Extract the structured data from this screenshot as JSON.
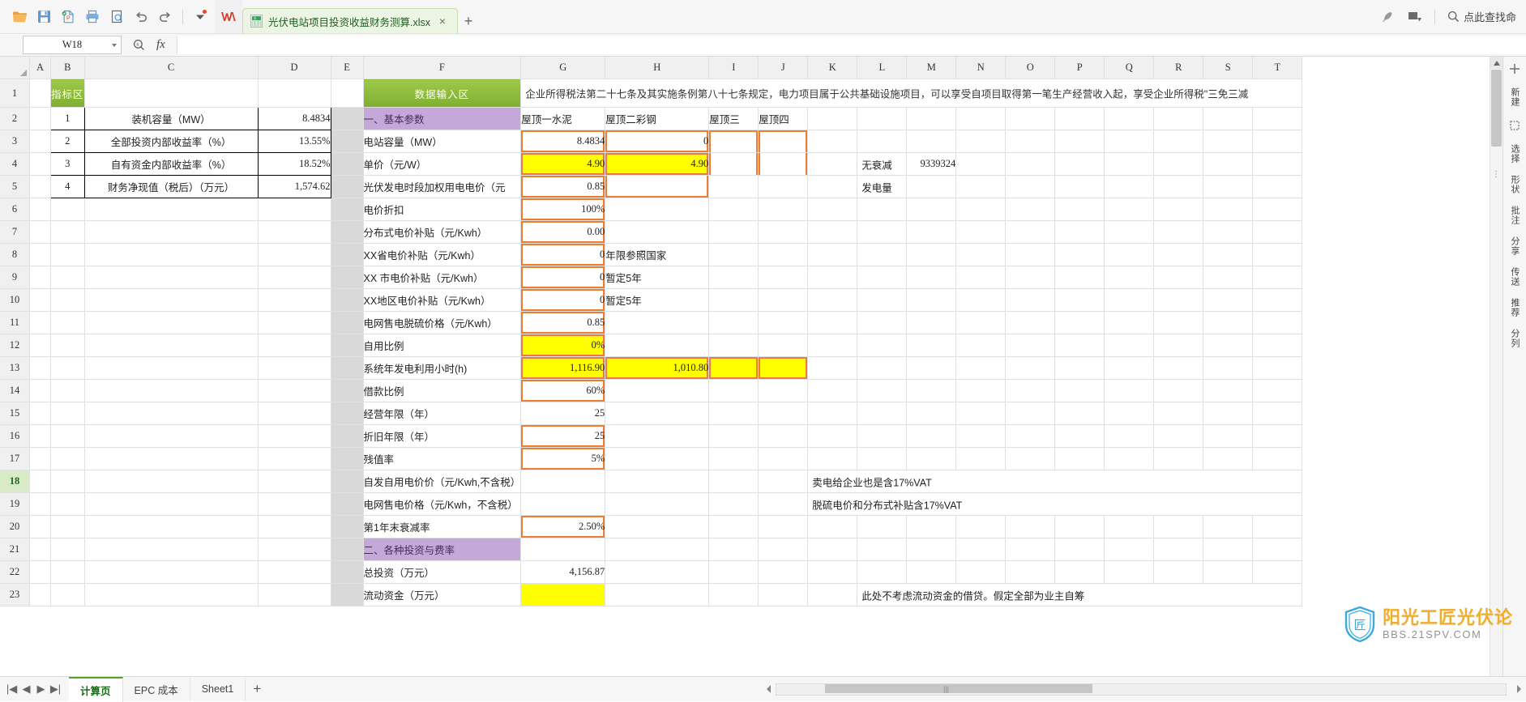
{
  "window": {
    "app_name": "WPS Spreadsheets",
    "document_tab": "光伏电站项目投资收益财务测算.xlsx",
    "new_tab_label": "+",
    "close_label": "×",
    "search_placeholder": "点此查找命"
  },
  "quick_access": [
    {
      "name": "open-icon",
      "tip": "打开"
    },
    {
      "name": "save-icon",
      "tip": "保存"
    },
    {
      "name": "export-pdf-icon",
      "tip": "输出为PDF"
    },
    {
      "name": "print-icon",
      "tip": "打印"
    },
    {
      "name": "print-preview-icon",
      "tip": "打印预览"
    },
    {
      "name": "undo-icon",
      "tip": "撤消"
    },
    {
      "name": "redo-icon",
      "tip": "恢复"
    },
    {
      "name": "customize-dropdown-icon",
      "tip": "自定义快速访问工具栏"
    }
  ],
  "formula_bar": {
    "name_box": "W18",
    "zoom_icon": "search-icon",
    "fx_label": "fx",
    "formula_value": ""
  },
  "grid": {
    "columns": [
      "A",
      "B",
      "C",
      "D",
      "E",
      "F",
      "G",
      "H",
      "I",
      "J",
      "K",
      "L",
      "M",
      "N",
      "O",
      "P",
      "Q",
      "R",
      "S",
      "T"
    ],
    "rows": [
      "1",
      "2",
      "3",
      "4",
      "5",
      "6",
      "7",
      "8",
      "9",
      "10",
      "11",
      "12",
      "13",
      "14",
      "15",
      "16",
      "17",
      "18",
      "19",
      "20",
      "21",
      "22",
      "23"
    ],
    "selected_row": "18",
    "selected_cell": "W18"
  },
  "section_headers": {
    "indicator": "指标区",
    "data_input": "数据输入区",
    "basic_params": "一、基本参数",
    "investment_rates": "二、各种投资与费率"
  },
  "indicator_table": [
    {
      "no": "1",
      "label": "装机容量（MW）",
      "value": "8.4834"
    },
    {
      "no": "2",
      "label": "全部投资内部收益率（%）",
      "value": "13.55%"
    },
    {
      "no": "3",
      "label": "自有资金内部收益率（%）",
      "value": "18.52%"
    },
    {
      "no": "4",
      "label": "财务净现值（税后）（万元）",
      "value": "1,574.62"
    }
  ],
  "tax_note": "企业所得税法第二十七条及其实施条例第八十七条规定，电力项目属于公共基础设施项目，可以享受自项目取得第一笔生产经营收入起，享受企业所得税\"三免三减",
  "scenario_headers": [
    "屋顶一水泥",
    "屋顶二彩钢",
    "屋顶三",
    "屋顶四"
  ],
  "no_degradation": {
    "label_line1": "无衰减",
    "label_line2": "发电量",
    "value": "9339324"
  },
  "param_rows": [
    {
      "row": "3",
      "label": "电站容量（MW）",
      "g": "8.4834",
      "h": "0",
      "i": "",
      "j": "",
      "note": "",
      "g_style": "orange",
      "h_style": "orange"
    },
    {
      "row": "4",
      "label": "单价（元/W）",
      "g": "4.90",
      "h": "4.90",
      "i": "",
      "j": "",
      "note": "",
      "g_style": "yellow-orange",
      "h_style": "yellow-orange"
    },
    {
      "row": "5",
      "label": "光伏发电时段加权用电电价（元",
      "g": "0.85",
      "h": "",
      "i": "",
      "j": "",
      "note": "",
      "g_style": "orange",
      "h_style": "orange"
    },
    {
      "row": "6",
      "label": "电价折扣",
      "g": "100%",
      "h": "",
      "i": "",
      "j": "",
      "note": "",
      "g_style": "orange",
      "h_style": ""
    },
    {
      "row": "7",
      "label": "分布式电价补贴（元/Kwh）",
      "g": "0.00",
      "h": "",
      "i": "",
      "j": "",
      "note": "",
      "g_style": "orange",
      "h_style": ""
    },
    {
      "row": "8",
      "label": "XX省电价补贴（元/Kwh）",
      "g": "0",
      "h": "年限参照国家",
      "i": "",
      "j": "",
      "note": "",
      "g_style": "orange",
      "h_style": ""
    },
    {
      "row": "9",
      "label": "XX 市电价补贴（元/Kwh）",
      "g": "0",
      "h": "暂定5年",
      "i": "",
      "j": "",
      "note": "",
      "g_style": "orange",
      "h_style": ""
    },
    {
      "row": "10",
      "label": "XX地区电价补贴（元/Kwh）",
      "g": "0",
      "h": "暂定5年",
      "i": "",
      "j": "",
      "note": "",
      "g_style": "orange",
      "h_style": ""
    },
    {
      "row": "11",
      "label": "电网售电脱硫价格（元/Kwh）",
      "g": "0.85",
      "h": "",
      "i": "",
      "j": "",
      "note": "",
      "g_style": "orange",
      "h_style": ""
    },
    {
      "row": "12",
      "label": "自用比例",
      "g": "0%",
      "h": "",
      "i": "",
      "j": "",
      "note": "",
      "g_style": "yellow-orange",
      "h_style": ""
    },
    {
      "row": "13",
      "label": "系统年发电利用小时(h)",
      "g": "1,116.90",
      "h": "1,010.80",
      "i": "",
      "j": "",
      "note": "",
      "g_style": "yellow-orange",
      "h_style": "yellow-orange"
    },
    {
      "row": "14",
      "label": "借款比例",
      "g": "60%",
      "h": "",
      "i": "",
      "j": "",
      "note": "",
      "g_style": "orange",
      "h_style": ""
    },
    {
      "row": "15",
      "label": "经营年限（年）",
      "g": "25",
      "h": "",
      "i": "",
      "j": "",
      "note": "",
      "g_style": "plain",
      "h_style": ""
    },
    {
      "row": "16",
      "label": "折旧年限（年）",
      "g": "25",
      "h": "",
      "i": "",
      "j": "",
      "note": "",
      "g_style": "orange",
      "h_style": ""
    },
    {
      "row": "17",
      "label": "残值率",
      "g": "5%",
      "h": "",
      "i": "",
      "j": "",
      "note": "",
      "g_style": "orange",
      "h_style": ""
    },
    {
      "row": "18",
      "label": "自发自用电价价（元/Kwh,不含税）",
      "g": "",
      "h": "",
      "i": "",
      "j": "",
      "note": "卖电给企业也是含17%VAT",
      "g_style": "plain",
      "h_style": ""
    },
    {
      "row": "19",
      "label": "电网售电价格（元/Kwh，不含税）",
      "g": "",
      "h": "",
      "i": "",
      "j": "",
      "note": "脱硫电价和分布式补贴含17%VAT",
      "g_style": "plain",
      "h_style": ""
    },
    {
      "row": "20",
      "label": "第1年末衰减率",
      "g": "2.50%",
      "h": "",
      "i": "",
      "j": "",
      "note": "",
      "g_style": "orange",
      "h_style": ""
    }
  ],
  "invest_rows": [
    {
      "row": "22",
      "label": "总投资（万元）",
      "g": "4,156.87",
      "note": "",
      "g_style": "plain"
    },
    {
      "row": "23",
      "label": "流动资金（万元）",
      "g": "",
      "note": "此处不考虑流动资金的借贷。假定全部为业主自筹",
      "g_style": "yellow"
    }
  ],
  "sheet_tabs": [
    {
      "label": "计算页",
      "active": true
    },
    {
      "label": "EPC 成本",
      "active": false
    },
    {
      "label": "Sheet1",
      "active": false
    }
  ],
  "sheet_nav": {
    "first": "|◀",
    "prev": "◀",
    "next": "▶",
    "last": "▶|",
    "add": "+"
  },
  "right_panel_items": [
    "新建",
    "选择",
    "形状",
    "批注",
    "分享",
    "传送",
    "推荐",
    "分列"
  ],
  "watermark": {
    "main": "阳光工匠光伏论",
    "sub": "BBS.21SPV.COM"
  },
  "colors": {
    "green_header": "#7fae31",
    "purple_header": "#c4a8d8",
    "orange_border": "#ed7d31",
    "yellow_fill": "#ffff00",
    "tab_green": "#ecf5e4",
    "accent": "#57a02c"
  }
}
